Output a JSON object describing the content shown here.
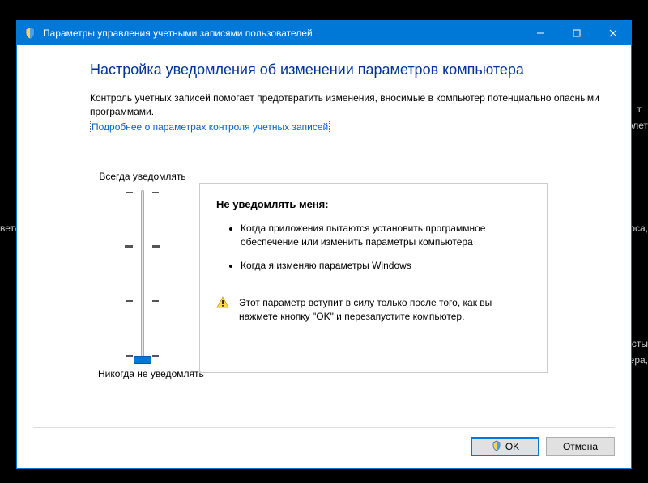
{
  "window": {
    "title": "Параметры управления учетными записями пользователей"
  },
  "main": {
    "heading": "Настройка уведомления об изменении параметров компьютера",
    "description": "Контроль учетных записей помогает предотвратить изменения, вносимые в компьютер потенциально опасными программами.",
    "link_text": "Подробнее о параметрах контроля учетных записей"
  },
  "slider": {
    "top_label": "Всегда уведомлять",
    "bottom_label": "Никогда не уведомлять",
    "level": 0,
    "levels_total": 4
  },
  "panel": {
    "title": "Не уведомлять меня:",
    "bullets": [
      "Когда приложения пытаются установить программное обеспечение или изменить параметры компьютера",
      "Когда я изменяю параметры Windows"
    ],
    "warning": "Этот параметр вступит в силу только после того, как вы нажмете кнопку \"OK\" и перезапустите компьютер."
  },
  "buttons": {
    "ok": "OK",
    "cancel": "Отмена"
  },
  "background_fragments": {
    "f1": "т",
    "f2": "молет",
    "f3": "вета",
    "f4": "оса,",
    "f5": "льносты",
    "f6": "мера,"
  }
}
